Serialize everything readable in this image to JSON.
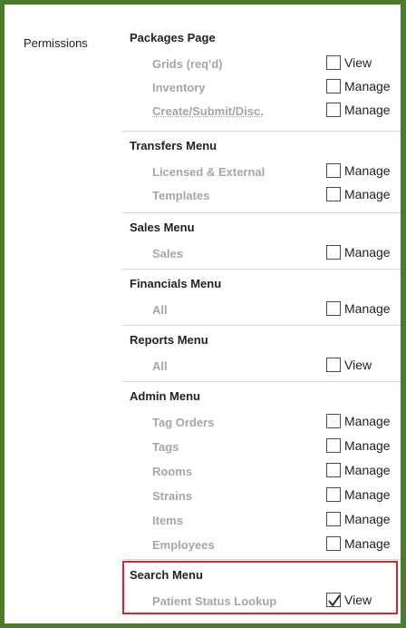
{
  "permissions_label": "Permissions",
  "sections": [
    {
      "title": "Packages Page",
      "rows": [
        {
          "label": "Grids (req'd)",
          "checkbox_label": "View",
          "checked": false
        },
        {
          "label": "Inventory",
          "checkbox_label": "Manage",
          "checked": false
        },
        {
          "label": "Create/Submit/Disc.",
          "checkbox_label": "Manage",
          "checked": false
        }
      ]
    },
    {
      "title": "Transfers Menu",
      "rows": [
        {
          "label": "Licensed & External",
          "checkbox_label": "Manage",
          "checked": false
        },
        {
          "label": "Templates",
          "checkbox_label": "Manage",
          "checked": false
        }
      ]
    },
    {
      "title": "Sales Menu",
      "rows": [
        {
          "label": "Sales",
          "checkbox_label": "Manage",
          "checked": false
        }
      ]
    },
    {
      "title": "Financials Menu",
      "rows": [
        {
          "label": "All",
          "checkbox_label": "Manage",
          "checked": false
        }
      ]
    },
    {
      "title": "Reports Menu",
      "rows": [
        {
          "label": "All",
          "checkbox_label": "View",
          "checked": false
        }
      ]
    },
    {
      "title": "Admin Menu",
      "rows": [
        {
          "label": "Tag Orders",
          "checkbox_label": "Manage",
          "checked": false
        },
        {
          "label": "Tags",
          "checkbox_label": "Manage",
          "checked": false
        },
        {
          "label": "Rooms",
          "checkbox_label": "Manage",
          "checked": false
        },
        {
          "label": "Strains",
          "checkbox_label": "Manage",
          "checked": false
        },
        {
          "label": "Items",
          "checkbox_label": "Manage",
          "checked": false
        },
        {
          "label": "Employees",
          "checkbox_label": "Manage",
          "checked": false
        }
      ]
    },
    {
      "title": "Search Menu",
      "rows": [
        {
          "label": "Patient Status Lookup",
          "checkbox_label": "View",
          "checked": true
        }
      ]
    }
  ],
  "colors": {
    "frame_border": "#4e7a2e",
    "highlight_border": "#e0222d",
    "muted_label": "#a6a6a6",
    "heading_text": "#222222"
  }
}
